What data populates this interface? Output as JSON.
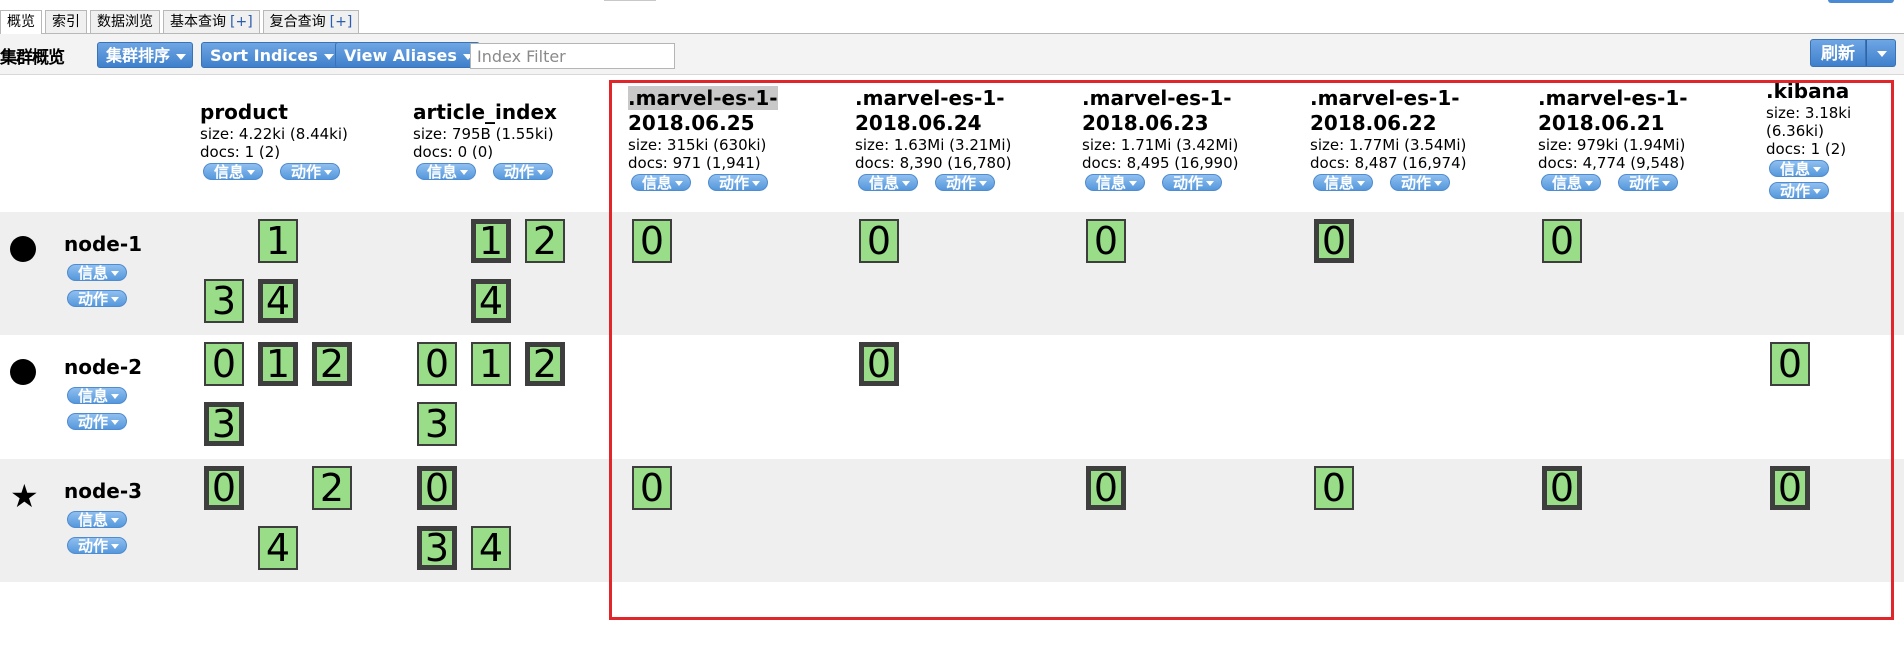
{
  "tabs": [
    {
      "label": "概览"
    },
    {
      "label": "索引"
    },
    {
      "label": "数据浏览"
    },
    {
      "label": "基本查询",
      "plus": "[+]"
    },
    {
      "label": "复合查询",
      "plus": "[+]"
    }
  ],
  "toolbar": {
    "title": "集群概览",
    "cluster_sort": "集群排序",
    "sort_indices": "Sort Indices",
    "view_aliases": "View Aliases",
    "index_filter_placeholder": "Index Filter",
    "refresh": "刷新"
  },
  "pill_labels": {
    "info": "信息",
    "action": "动作"
  },
  "indices": [
    {
      "name_lines": [
        "product"
      ],
      "size": "size: 4.22ki (8.44ki)",
      "docs": "docs: 1 (2)"
    },
    {
      "name_lines": [
        "article_index"
      ],
      "size": "size: 795B (1.55ki)",
      "docs": "docs: 0 (0)"
    },
    {
      "name_lines": [
        ".marvel-es-1-",
        "2018.06.25"
      ],
      "size": "size: 315ki (630ki)",
      "docs": "docs: 971 (1,941)"
    },
    {
      "name_lines": [
        ".marvel-es-1-",
        "2018.06.24"
      ],
      "size": "size: 1.63Mi (3.21Mi)",
      "docs": "docs: 8,390 (16,780)"
    },
    {
      "name_lines": [
        ".marvel-es-1-",
        "2018.06.23"
      ],
      "size": "size: 1.71Mi (3.42Mi)",
      "docs": "docs: 8,495 (16,990)"
    },
    {
      "name_lines": [
        ".marvel-es-1-",
        "2018.06.22"
      ],
      "size": "size: 1.77Mi (3.54Mi)",
      "docs": "docs: 8,487 (16,974)"
    },
    {
      "name_lines": [
        ".marvel-es-1-",
        "2018.06.21"
      ],
      "size": "size: 979ki (1.94Mi)",
      "docs": "docs: 4,774 (9,548)"
    },
    {
      "name_lines": [
        ".kibana"
      ],
      "size_lines": [
        "size: 3.18ki",
        "(6.36ki)"
      ],
      "docs": "docs: 1 (2)"
    }
  ],
  "nodes": [
    {
      "name": "node-1",
      "marker": "circle"
    },
    {
      "name": "node-2",
      "marker": "circle"
    },
    {
      "name": "node-3",
      "marker": "star"
    }
  ],
  "shards": [
    {
      "node": 0,
      "index": 0,
      "slot": 1,
      "line": 0,
      "label": "1",
      "primary": false
    },
    {
      "node": 0,
      "index": 0,
      "slot": 0,
      "line": 1,
      "label": "3",
      "primary": false
    },
    {
      "node": 0,
      "index": 0,
      "slot": 1,
      "line": 1,
      "label": "4",
      "primary": true
    },
    {
      "node": 0,
      "index": 1,
      "slot": 1,
      "line": 0,
      "label": "1",
      "primary": true
    },
    {
      "node": 0,
      "index": 1,
      "slot": 2,
      "line": 0,
      "label": "2",
      "primary": false
    },
    {
      "node": 0,
      "index": 1,
      "slot": 1,
      "line": 1,
      "label": "4",
      "primary": true
    },
    {
      "node": 0,
      "index": 2,
      "slot": 0,
      "line": 0,
      "label": "0",
      "primary": false
    },
    {
      "node": 0,
      "index": 3,
      "slot": 0,
      "line": 0,
      "label": "0",
      "primary": false
    },
    {
      "node": 0,
      "index": 4,
      "slot": 0,
      "line": 0,
      "label": "0",
      "primary": false
    },
    {
      "node": 0,
      "index": 5,
      "slot": 0,
      "line": 0,
      "label": "0",
      "primary": true
    },
    {
      "node": 0,
      "index": 6,
      "slot": 0,
      "line": 0,
      "label": "0",
      "primary": false
    },
    {
      "node": 1,
      "index": 0,
      "slot": 0,
      "line": 0,
      "label": "0",
      "primary": false
    },
    {
      "node": 1,
      "index": 0,
      "slot": 1,
      "line": 0,
      "label": "1",
      "primary": true
    },
    {
      "node": 1,
      "index": 0,
      "slot": 2,
      "line": 0,
      "label": "2",
      "primary": true
    },
    {
      "node": 1,
      "index": 0,
      "slot": 0,
      "line": 1,
      "label": "3",
      "primary": true
    },
    {
      "node": 1,
      "index": 1,
      "slot": 0,
      "line": 0,
      "label": "0",
      "primary": false
    },
    {
      "node": 1,
      "index": 1,
      "slot": 1,
      "line": 0,
      "label": "1",
      "primary": false
    },
    {
      "node": 1,
      "index": 1,
      "slot": 2,
      "line": 0,
      "label": "2",
      "primary": true
    },
    {
      "node": 1,
      "index": 1,
      "slot": 0,
      "line": 1,
      "label": "3",
      "primary": false
    },
    {
      "node": 1,
      "index": 3,
      "slot": 0,
      "line": 0,
      "label": "0",
      "primary": true
    },
    {
      "node": 1,
      "index": 7,
      "slot": 0,
      "line": 0,
      "label": "0",
      "primary": false
    },
    {
      "node": 2,
      "index": 0,
      "slot": 0,
      "line": 0,
      "label": "0",
      "primary": true
    },
    {
      "node": 2,
      "index": 0,
      "slot": 2,
      "line": 0,
      "label": "2",
      "primary": false
    },
    {
      "node": 2,
      "index": 0,
      "slot": 1,
      "line": 1,
      "label": "4",
      "primary": false
    },
    {
      "node": 2,
      "index": 1,
      "slot": 0,
      "line": 0,
      "label": "0",
      "primary": true
    },
    {
      "node": 2,
      "index": 1,
      "slot": 0,
      "line": 1,
      "label": "3",
      "primary": true
    },
    {
      "node": 2,
      "index": 1,
      "slot": 1,
      "line": 1,
      "label": "4",
      "primary": false
    },
    {
      "node": 2,
      "index": 2,
      "slot": 0,
      "line": 0,
      "label": "0",
      "primary": false
    },
    {
      "node": 2,
      "index": 4,
      "slot": 0,
      "line": 0,
      "label": "0",
      "primary": true
    },
    {
      "node": 2,
      "index": 5,
      "slot": 0,
      "line": 0,
      "label": "0",
      "primary": false
    },
    {
      "node": 2,
      "index": 6,
      "slot": 0,
      "line": 0,
      "label": "0",
      "primary": true
    },
    {
      "node": 2,
      "index": 7,
      "slot": 0,
      "line": 0,
      "label": "0",
      "primary": true
    }
  ],
  "colors": {
    "shard_fill": "#99dd88",
    "shard_border": "#3e3e3e",
    "button_blue": "#3f80cc",
    "highlight_red": "#e0262b",
    "row_shade": "#efefef"
  }
}
